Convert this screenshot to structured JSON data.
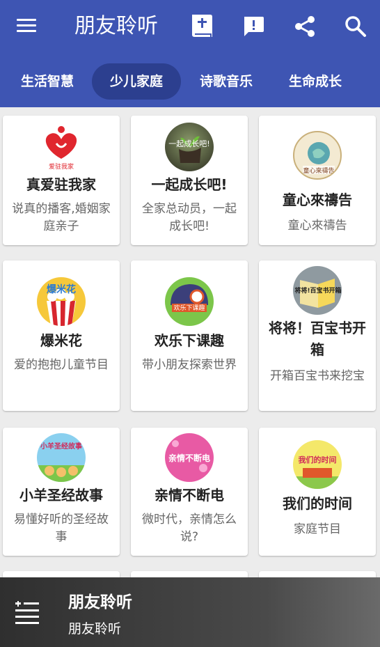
{
  "app": {
    "title": "朋友聆听"
  },
  "toolbar": {
    "icons": [
      "menu-icon",
      "bible-icon",
      "feedback-icon",
      "share-icon",
      "search-icon"
    ]
  },
  "tabs": [
    {
      "label": "生活智慧",
      "active": false
    },
    {
      "label": "少儿家庭",
      "active": true
    },
    {
      "label": "诗歌音乐",
      "active": false
    },
    {
      "label": "生命成长",
      "active": false
    }
  ],
  "programs": [
    {
      "name": "真爱驻我家",
      "desc": "说真的播客,婚姻家庭亲子",
      "logo_text": "爱驻我家"
    },
    {
      "name": "一起成长吧!",
      "desc": "全家总动员，一起成长吧!",
      "logo_text": "一起成长吧!"
    },
    {
      "name": "童心來禱告",
      "desc": "童心來禱告",
      "logo_text": "童心來禱告"
    },
    {
      "name": "爆米花",
      "desc": "爱的抱抱儿童节目",
      "logo_text": "爆米花"
    },
    {
      "name": "欢乐下课趣",
      "desc": "带小朋友探索世界",
      "logo_text": "欢乐下课趣"
    },
    {
      "name": "将将！百宝书开箱",
      "desc": "开箱百宝书来挖宝",
      "logo_text": "将将!百宝书开箱"
    },
    {
      "name": "小羊圣经故事",
      "desc": "易懂好听的圣经故事",
      "logo_text": "小羊圣经故事"
    },
    {
      "name": "亲情不断电",
      "desc": "微时代，亲情怎么说?",
      "logo_text": "亲情不断电"
    },
    {
      "name": "我们的时间",
      "desc": "家庭节目",
      "logo_text": "我们的时间"
    }
  ],
  "player": {
    "title": "朋友聆听",
    "subtitle": "朋友聆听"
  },
  "colors": {
    "primary": "#3e55b3",
    "tab_active": "#2c3f8f",
    "background": "#ececec"
  }
}
